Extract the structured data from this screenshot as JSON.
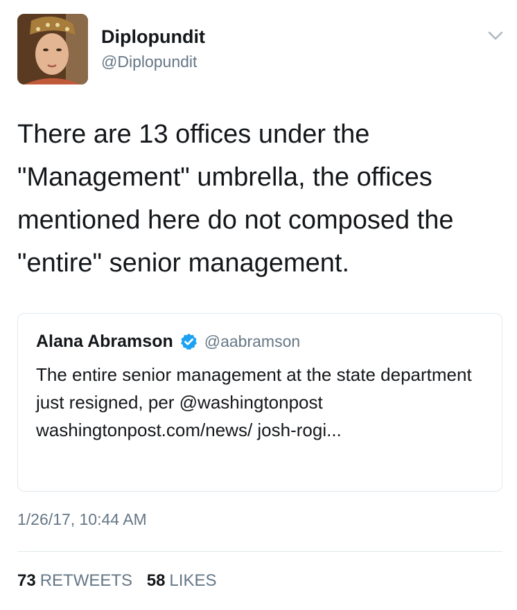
{
  "tweet": {
    "author": {
      "name": "Diplopundit",
      "handle": "@Diplopundit",
      "avatar": "portrait-painting-avatar"
    },
    "menu_icon": "chevron-down-icon",
    "text": "There are 13 offices under the \"Management\" umbrella, the offices mentioned here do not composed the \"entire\" senior management.",
    "quoted_tweet": {
      "name": "Alana Abramson",
      "handle": "@aabramson",
      "verified_icon": "verified-badge-icon",
      "text": "The entire senior management at the state department just resigned, per @washingtonpost washingtonpost.com/news/ josh-rogi..."
    },
    "timestamp": "1/26/17, 10:44 AM",
    "stats": {
      "retweets_count": "73",
      "retweets_label": "RETWEETS",
      "likes_count": "58",
      "likes_label": "LIKES"
    }
  },
  "colors": {
    "text": "#14171a",
    "secondary": "#657786",
    "border": "#e1e8ed",
    "verified": "#1da1f2"
  }
}
